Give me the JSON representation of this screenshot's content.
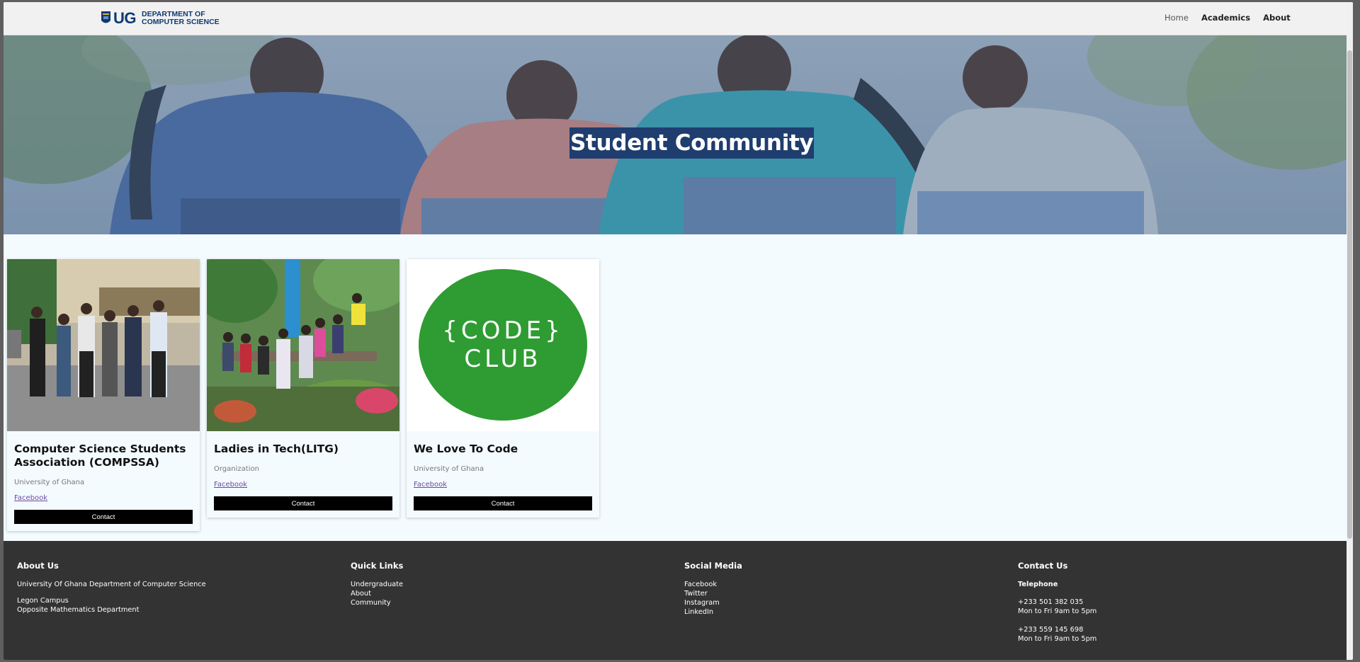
{
  "nav": {
    "logo_ug": "UG",
    "logo_line1": "DEPARTMENT OF",
    "logo_line2": "COMPUTER SCIENCE",
    "links": [
      "Home",
      "Academics",
      "About"
    ]
  },
  "hero": {
    "title": "Student Community"
  },
  "cards": [
    {
      "title": "Computer Science Students Association (COMPSSA)",
      "subtitle": "University of Ghana",
      "link": "Facebook",
      "button": "Contact"
    },
    {
      "title": "Ladies in Tech(LITG)",
      "subtitle": "Organization",
      "link": "Facebook",
      "button": "Contact"
    },
    {
      "title": "We Love To Code",
      "subtitle": "University of Ghana",
      "link": "Facebook",
      "button": "Contact",
      "logo_line1": "{CODE}",
      "logo_line2": "CLUB"
    }
  ],
  "footer": {
    "about": {
      "heading": "About Us",
      "line1": "University Of Ghana Department of Computer Science",
      "line2": "Legon Campus",
      "line3": "Opposite Mathematics Department"
    },
    "quick_links": {
      "heading": "Quick Links",
      "items": [
        "Undergraduate",
        "About",
        "Community"
      ]
    },
    "social": {
      "heading": "Social Media",
      "items": [
        "Facebook",
        "Twitter",
        "Instagram",
        "LinkedIn"
      ]
    },
    "contact": {
      "heading": "Contact Us",
      "telephone_label": "Telephone",
      "phone1": "+233 501 382 035",
      "hours1": "Mon to Fri 9am to 5pm",
      "phone2": "+233 559 145 698",
      "hours2": "Mon to Fri 9am to 5pm"
    }
  },
  "colors": {
    "brand_navy": "#0d3a74",
    "footer_bg": "#333333",
    "page_bg": "#f4fbff",
    "button_bg": "#000000",
    "code_club_green": "#2e9c32"
  }
}
